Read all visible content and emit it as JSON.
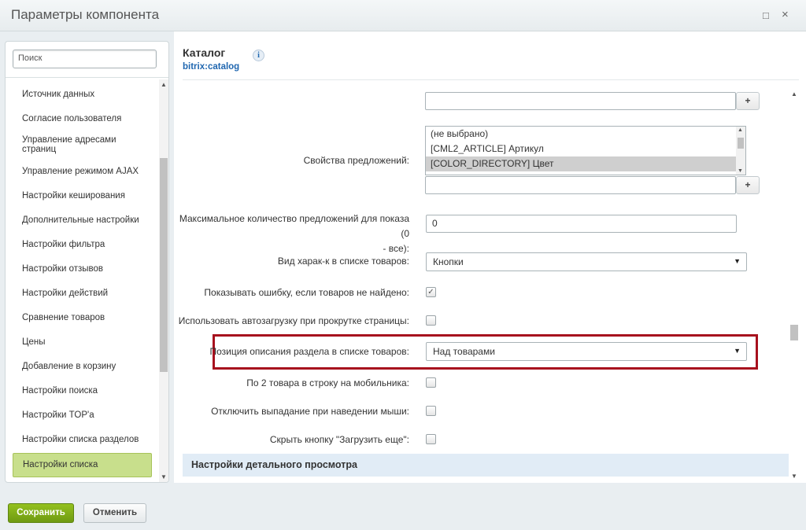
{
  "window": {
    "title": "Параметры компонента",
    "restore_icon": "□",
    "close_icon": "×"
  },
  "sidebar": {
    "search_placeholder": "Поиск",
    "items": [
      "Источник данных",
      "Согласие пользователя",
      "Управление адресами страниц",
      "Управление режимом AJAX",
      "Настройки кеширования",
      "Дополнительные настройки",
      "Настройки фильтра",
      "Настройки отзывов",
      "Настройки действий",
      "Сравнение товаров",
      "Цены",
      "Добавление в корзину",
      "Настройки поиска",
      "Настройки TOP'а",
      "Настройки списка разделов",
      "Настройки списка"
    ],
    "active_item": "Настройки списка"
  },
  "header": {
    "title": "Каталог",
    "subtitle": "bitrix:catalog",
    "info_icon": "i"
  },
  "form": {
    "plus_label": "+",
    "offer_props": {
      "label": "Свойства предложений:",
      "options": [
        "(не выбрано)",
        "[CML2_ARTICLE] Артикул",
        "[COLOR_DIRECTORY] Цвет"
      ],
      "selected": "[COLOR_DIRECTORY] Цвет"
    },
    "max_offers": {
      "label_line1": "Максимальное количество предложений для показа (0",
      "label_line2": "- все):",
      "value": "0"
    },
    "props_view": {
      "label": "Вид харак-к в списке товаров:",
      "value": "Кнопки"
    },
    "show_error": {
      "label": "Показывать ошибку, если товаров не найдено:",
      "checked": true
    },
    "autoload": {
      "label": "Использовать автозагрузку при прокрутке страницы:",
      "checked": false
    },
    "section_desc_pos": {
      "label": "Позиция описания раздела в списке товаров:",
      "value": "Над товарами"
    },
    "two_per_row": {
      "label": "По 2 товара в строку на мобильника:",
      "checked": false
    },
    "disable_hover": {
      "label": "Отключить выпадание при наведении мыши:",
      "checked": false
    },
    "hide_load_more": {
      "label": "Скрыть кнопку \"Загрузить еще\":",
      "checked": false
    },
    "section_heading": "Настройки детального просмотра"
  },
  "footer": {
    "save_label": "Сохранить",
    "cancel_label": "Отменить"
  },
  "colors": {
    "accent_green": "#84b21a",
    "highlight_red": "#a7111e",
    "link_blue": "#2067b0",
    "active_item_bg": "#c8df8c"
  }
}
